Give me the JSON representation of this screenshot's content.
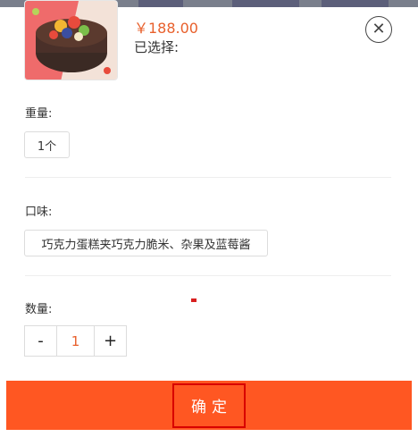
{
  "product": {
    "price": "￥188.00",
    "selected_label": "已选择:"
  },
  "weight": {
    "title": "重量:",
    "options": [
      "1个"
    ]
  },
  "flavor": {
    "title": "口味:",
    "options": [
      "巧克力蛋糕夹巧克力脆米、杂果及蓝莓酱"
    ]
  },
  "quantity": {
    "title": "数量:",
    "minus_label": "-",
    "value": "1",
    "plus_label": "+"
  },
  "confirm_label": "确定",
  "colors": {
    "accent": "#ff5722",
    "price": "#e8602c"
  },
  "icons": {
    "close": "close-circle-icon"
  }
}
